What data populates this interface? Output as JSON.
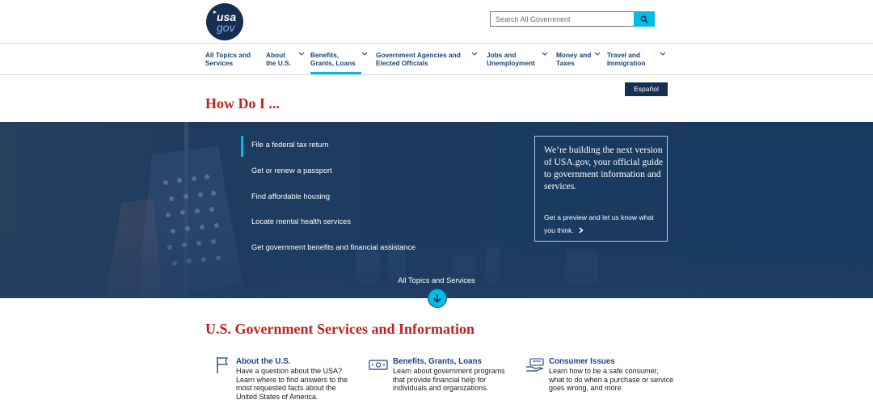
{
  "header": {
    "logo_usa": "usa",
    "logo_gov": "gov",
    "search_placeholder": "Search All Government"
  },
  "nav": [
    {
      "label_line1": "All Topics and",
      "label_line2": "Services",
      "has_dropdown": false
    },
    {
      "label_line1": "About",
      "label_line2": "the U.S.",
      "has_dropdown": true
    },
    {
      "label_line1": "Benefits,",
      "label_line2": "Grants, Loans",
      "has_dropdown": true,
      "active": true
    },
    {
      "label_line1": "Government Agencies and",
      "label_line2": "Elected Officials",
      "has_dropdown": true
    },
    {
      "label_line1": "Jobs and",
      "label_line2": "Unemployment",
      "has_dropdown": true
    },
    {
      "label_line1": "Money and",
      "label_line2": "Taxes",
      "has_dropdown": true
    },
    {
      "label_line1": "Travel and",
      "label_line2": "Immigration",
      "has_dropdown": true
    }
  ],
  "language_button": "Español",
  "how_do_i": "How Do I ...",
  "hero": {
    "links": [
      "File a federal tax return",
      "Get or renew a passport",
      "Find affordable housing",
      "Locate mental health services",
      "Get government benefits and financial assistance"
    ],
    "preview_title": "We’re building the next version of USA.gov, your official guide to government information and services.",
    "preview_link": "Get a preview and let us know what you think.",
    "all_topics": "All Topics and Services"
  },
  "services_title": "U.S. Government Services and Information",
  "cards": [
    {
      "title": "About the U.S.",
      "description": "Have a question about the USA? Learn where to find answers to the most requested facts about the United States of America.",
      "icon": "flag-icon"
    },
    {
      "title": "Benefits, Grants, Loans",
      "description": "Learn about government programs that provide financial help for individuals and organizations.",
      "icon": "money-icon"
    },
    {
      "title": "Consumer Issues",
      "description": "Learn how to be a safe consumer, what to do when a purchase or service goes wrong, and more.",
      "icon": "hand-money-icon"
    }
  ],
  "colors": {
    "navy": "#162e51",
    "link_blue": "#1a4480",
    "accent_cyan": "#00bde3",
    "heading_red": "#c41f1f",
    "hero_bg": "#1b3b60"
  }
}
